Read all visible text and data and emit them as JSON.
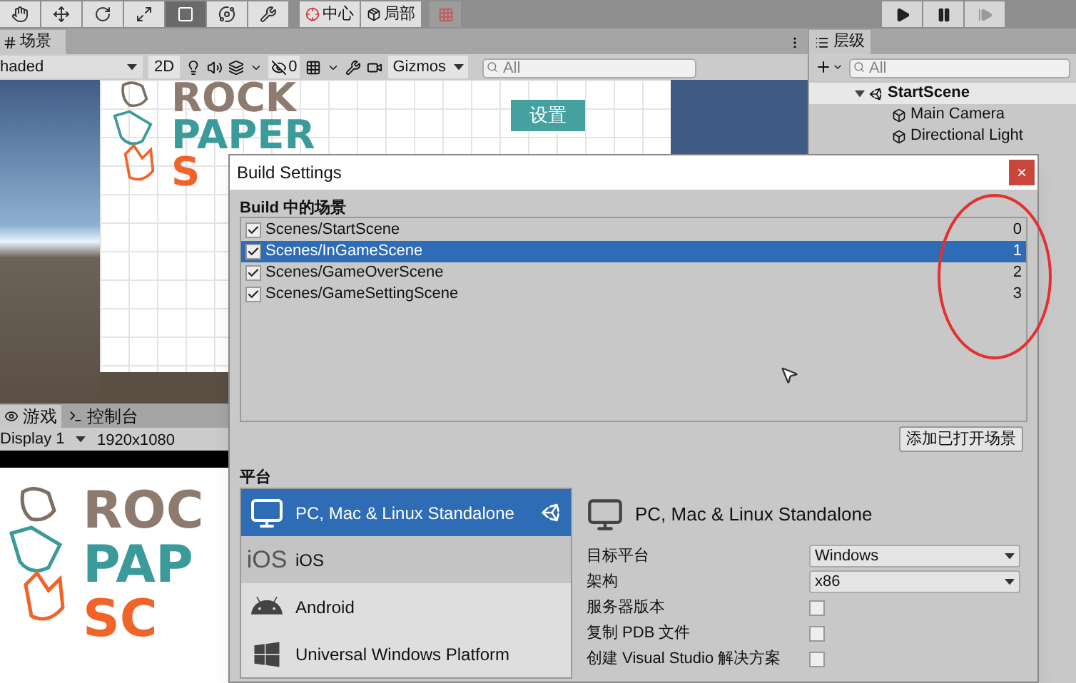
{
  "toolbar": {
    "tools": [
      {
        "kind": "hand",
        "selected": false
      },
      {
        "kind": "move",
        "selected": false
      },
      {
        "kind": "rotate",
        "selected": false
      },
      {
        "kind": "scale",
        "selected": false
      },
      {
        "kind": "rect",
        "selected": true
      },
      {
        "kind": "transform",
        "selected": false
      },
      {
        "kind": "tools",
        "selected": false
      }
    ],
    "pivot": "中心",
    "space": "局部",
    "playback": [
      {
        "kind": "play",
        "disabled": false
      },
      {
        "kind": "pause",
        "disabled": false
      },
      {
        "kind": "step",
        "disabled": true
      }
    ]
  },
  "scene_panel": {
    "tab": "场景",
    "shading": "haded",
    "mode": "2D",
    "hidden_count": "0",
    "gizmos": "Gizmos",
    "search": {
      "placeholder": "All"
    }
  },
  "scene_view": {
    "logo": [
      "ROCK",
      "PAPER",
      "S"
    ],
    "button": "设置"
  },
  "hierarchy": {
    "tab": "层级",
    "search": {
      "placeholder": "All"
    },
    "scene": "StartScene",
    "expanded": true,
    "items": [
      "Main Camera",
      "Directional Light"
    ]
  },
  "game_panel": {
    "tabs": [
      {
        "label": "游戏",
        "kind": "eye",
        "selected": true
      },
      {
        "label": "控制台",
        "kind": "console",
        "selected": false
      }
    ],
    "display": "Display 1",
    "resolution": "1920x1080",
    "logo": [
      "ROC",
      "PAP",
      "SC"
    ]
  },
  "build_settings": {
    "title": "Build Settings",
    "close": "×",
    "scenes_heading": "Build 中的场景",
    "scenes": [
      {
        "path": "Scenes/StartScene",
        "index": "0",
        "checked": true,
        "selected": false
      },
      {
        "path": "Scenes/InGameScene",
        "index": "1",
        "checked": true,
        "selected": true
      },
      {
        "path": "Scenes/GameOverScene",
        "index": "2",
        "checked": true,
        "selected": false
      },
      {
        "path": "Scenes/GameSettingScene",
        "index": "3",
        "checked": true,
        "selected": false
      }
    ],
    "add_button": "添加已打开场景",
    "platform_heading": "平台",
    "platforms": [
      {
        "name": "PC, Mac & Linux Standalone",
        "kind": "monitor",
        "selected": true,
        "hovered": false,
        "active": true
      },
      {
        "name": "iOS",
        "kind": "text",
        "icon_text": "iOS",
        "selected": false,
        "hovered": true,
        "active": false
      },
      {
        "name": "Android",
        "kind": "android",
        "selected": false,
        "hovered": false,
        "active": false
      },
      {
        "name": "Universal Windows Platform",
        "kind": "windows",
        "selected": false,
        "hovered": false,
        "active": false
      }
    ],
    "detail": {
      "title": "PC, Mac & Linux Standalone",
      "settings": [
        {
          "kind": "dropdown",
          "label": "目标平台",
          "value": "Windows"
        },
        {
          "kind": "dropdown",
          "label": "架构",
          "value": "x86"
        },
        {
          "kind": "checkbox",
          "label": "服务器版本",
          "checked": false
        },
        {
          "kind": "checkbox",
          "label": "复制 PDB 文件",
          "checked": false
        },
        {
          "kind": "checkbox",
          "label": "创建 Visual Studio 解决方案",
          "checked": false
        }
      ]
    }
  }
}
